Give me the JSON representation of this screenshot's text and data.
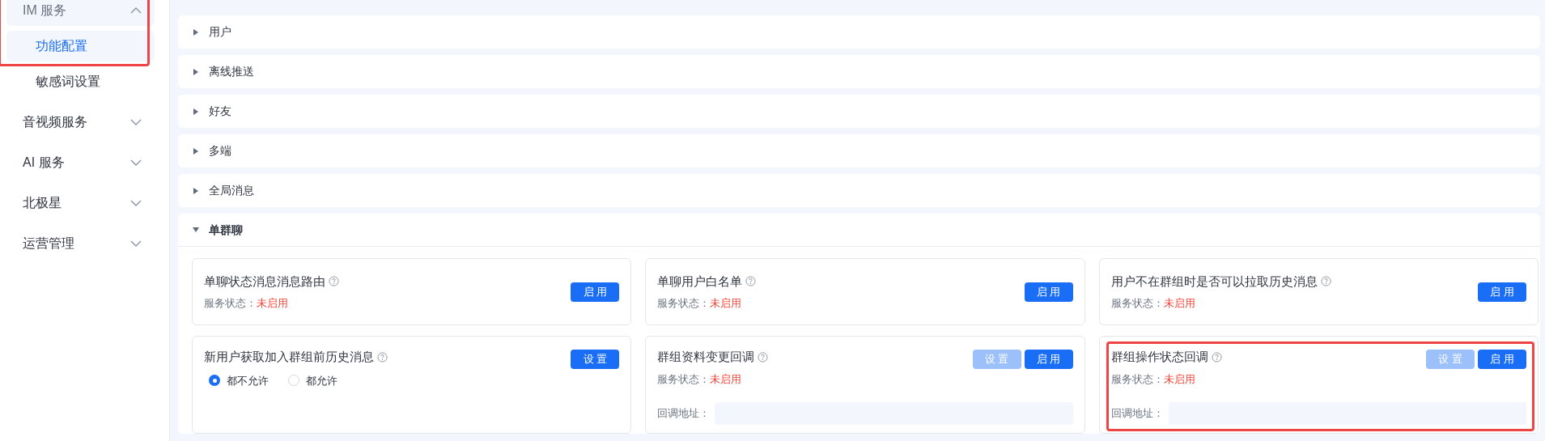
{
  "sidebar": {
    "groups": [
      {
        "label": "IM 服务",
        "expanded": true,
        "highlighted": true,
        "children": [
          {
            "label": "功能配置",
            "selected": true
          },
          {
            "label": "敏感词设置",
            "selected": false
          }
        ]
      },
      {
        "label": "音视频服务",
        "expanded": false,
        "highlighted": false
      },
      {
        "label": "AI 服务",
        "expanded": false,
        "highlighted": false
      },
      {
        "label": "北极星",
        "expanded": false,
        "highlighted": false
      },
      {
        "label": "运营管理",
        "expanded": false,
        "highlighted": false
      }
    ]
  },
  "sections": [
    {
      "title": "用户",
      "expanded": false
    },
    {
      "title": "离线推送",
      "expanded": false
    },
    {
      "title": "好友",
      "expanded": false
    },
    {
      "title": "多端",
      "expanded": false
    },
    {
      "title": "全局消息",
      "expanded": false
    },
    {
      "title": "单群聊",
      "expanded": true,
      "cards": [
        {
          "title": "单聊状态消息消息路由",
          "status_label": "服务状态：",
          "status_value": "未启用",
          "highlighted": false,
          "buttons": [
            {
              "label": "启 用",
              "disabled": false
            }
          ]
        },
        {
          "title": "单聊用户白名单",
          "status_label": "服务状态：",
          "status_value": "未启用",
          "highlighted": false,
          "buttons": [
            {
              "label": "启 用",
              "disabled": false
            }
          ]
        },
        {
          "title": "用户不在群组时是否可以拉取历史消息",
          "status_label": "服务状态：",
          "status_value": "未启用",
          "highlighted": false,
          "buttons": [
            {
              "label": "启 用",
              "disabled": false
            }
          ]
        },
        {
          "title": "新用户获取加入群组前历史消息",
          "highlighted": false,
          "radios": [
            {
              "label": "都不允许",
              "selected": true
            },
            {
              "label": "都允许",
              "selected": false
            }
          ],
          "buttons": [
            {
              "label": "设 置",
              "disabled": false
            }
          ]
        },
        {
          "title": "群组资料变更回调",
          "status_label": "服务状态：",
          "status_value": "未启用",
          "callback_label": "回调地址：",
          "highlighted": false,
          "buttons": [
            {
              "label": "设 置",
              "disabled": true
            },
            {
              "label": "启 用",
              "disabled": false
            }
          ]
        },
        {
          "title": "群组操作状态回调",
          "status_label": "服务状态：",
          "status_value": "未启用",
          "callback_label": "回调地址：",
          "highlighted": true,
          "buttons": [
            {
              "label": "设 置",
              "disabled": true
            },
            {
              "label": "启 用",
              "disabled": false
            }
          ]
        }
      ]
    }
  ]
}
